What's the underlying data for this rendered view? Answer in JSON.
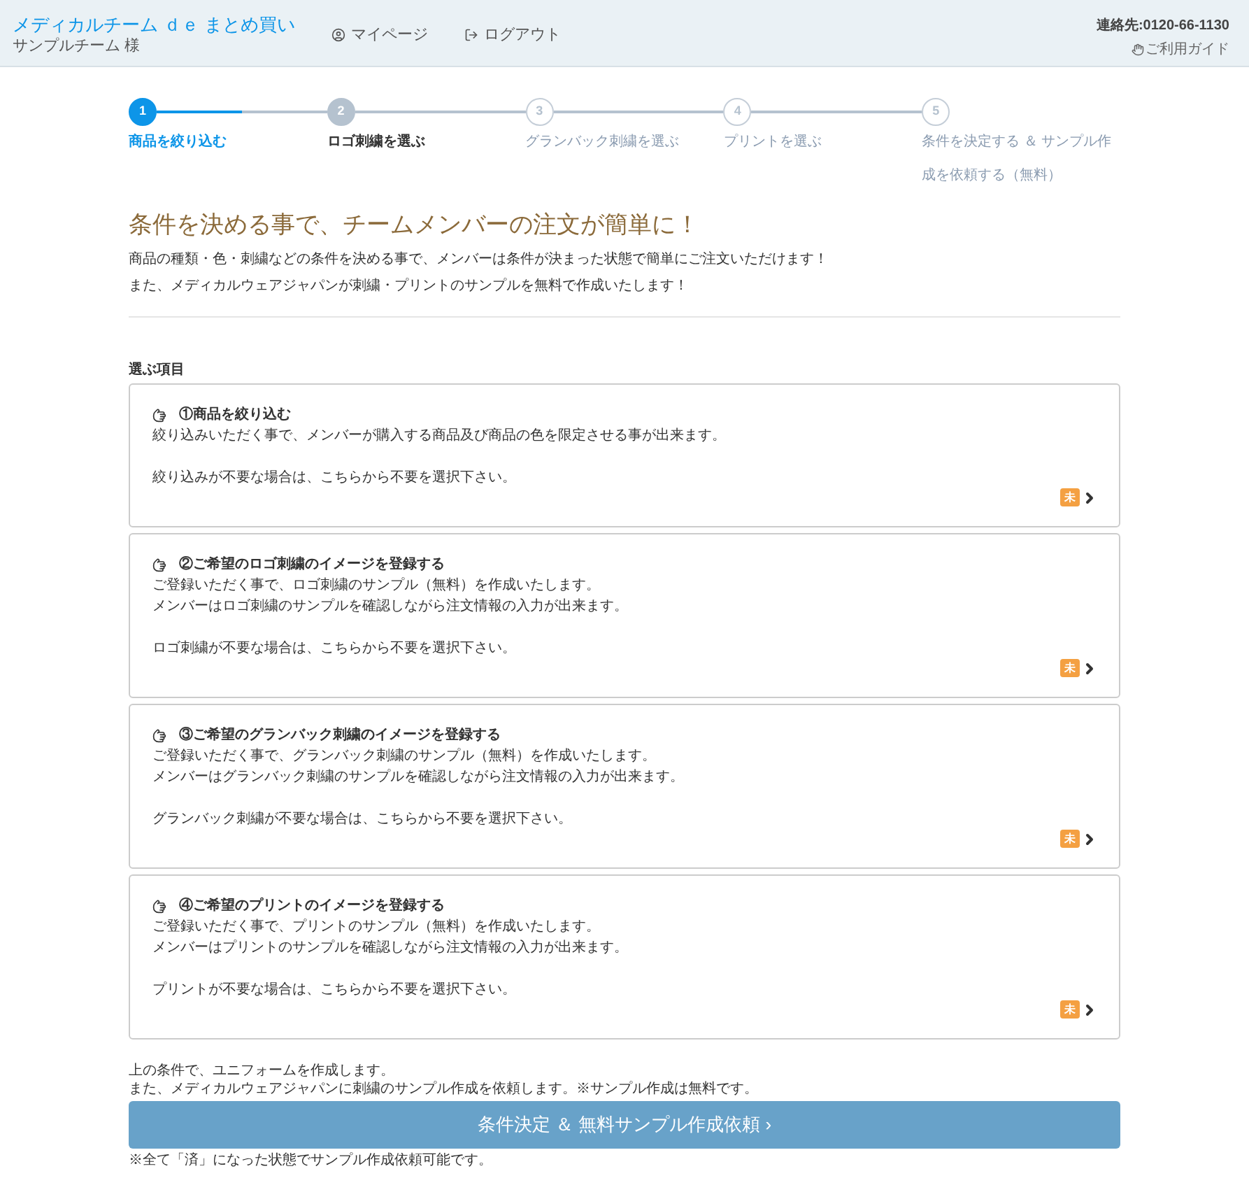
{
  "header": {
    "site_title": "メディカルチーム ｄｅ まとめ買い",
    "user": "サンプルチーム 様",
    "nav": [
      {
        "label": "マイページ",
        "kind": "user"
      },
      {
        "label": "ログアウト",
        "kind": "logout"
      }
    ],
    "contact": "連絡先:0120-66-1130",
    "guide": "ご利用ガイド"
  },
  "steps": [
    {
      "number": "1",
      "label": "商品を絞り込む",
      "kind": "done"
    },
    {
      "number": "2",
      "label": "ロゴ刺繍を選ぶ",
      "kind": "current"
    },
    {
      "number": "3",
      "label": "グランバック刺繍を選ぶ",
      "kind": "todo"
    },
    {
      "number": "4",
      "label": "プリントを選ぶ",
      "kind": "todo"
    },
    {
      "number": "5",
      "label": "条件を決定する ＆ サンプル作成を依頼する（無料）",
      "kind": "todo"
    }
  ],
  "intro": {
    "heading": "条件を決める事で、チームメンバーの注文が簡単に！",
    "lines": [
      "商品の種類・色・刺繍などの条件を決める事で、メンバーは条件が決まった状態で簡単にご注文いただけます！",
      "また、メディカルウェアジャパンが刺繍・プリントのサンプルを無料で作成いたします！"
    ]
  },
  "section_label": "選ぶ項目",
  "items": [
    {
      "title": "①商品を絞り込む",
      "description": [
        "絞り込みいただく事で、メンバーが購入する商品及び商品の色を限定させる事が出来ます。"
      ],
      "note": "絞り込みが不要な場合は、こちらから不要を選択下さい。",
      "badge": "未"
    },
    {
      "title": "②ご希望のロゴ刺繍のイメージを登録する",
      "description": [
        "ご登録いただく事で、ロゴ刺繍のサンプル（無料）を作成いたします。",
        "メンバーはロゴ刺繍のサンプルを確認しながら注文情報の入力が出来ます。"
      ],
      "note": "ロゴ刺繍が不要な場合は、こちらから不要を選択下さい。",
      "badge": "未"
    },
    {
      "title": "③ご希望のグランバック刺繍のイメージを登録する",
      "description": [
        "ご登録いただく事で、グランバック刺繍のサンプル（無料）を作成いたします。",
        "メンバーはグランバック刺繍のサンプルを確認しながら注文情報の入力が出来ます。"
      ],
      "note": "グランバック刺繍が不要な場合は、こちらから不要を選択下さい。",
      "badge": "未"
    },
    {
      "title": "④ご希望のプリントのイメージを登録する",
      "description": [
        "ご登録いただく事で、プリントのサンプル（無料）を作成いたします。",
        "メンバーはプリントのサンプルを確認しながら注文情報の入力が出来ます。"
      ],
      "note": "プリントが不要な場合は、こちらから不要を選択下さい。",
      "badge": "未"
    }
  ],
  "footer": {
    "lines": [
      "上の条件で、ユニフォームを作成します。",
      "また、メディカルウェアジャパンに刺繍のサンプル作成を依頼します。※サンプル作成は無料です。"
    ],
    "submit_button": "条件決定 ＆ 無料サンプル作成依頼 ›",
    "note": "※全て「済」になった状態でサンプル作成依頼可能です。"
  }
}
